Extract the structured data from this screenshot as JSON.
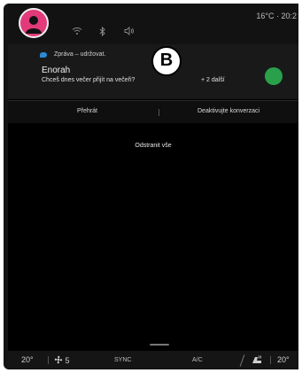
{
  "status_bar": {
    "temperature_text": "16°C · 20:2",
    "icons": [
      "wifi-icon",
      "bluetooth-icon",
      "volume-icon"
    ]
  },
  "notification": {
    "app_label": "Zpráva – udržovat.",
    "sender": "Enorah",
    "message": "Chceš dnes večer přijít na večeři?",
    "more": "+ 2 další",
    "badge": "B"
  },
  "actions": {
    "play": "Přehrát",
    "deactivate": "Deaktivujte konverzaci"
  },
  "clear_all": "Odstranit vše",
  "bottom_bar": {
    "left_temp": "20",
    "left_temp_unit": "°",
    "fan_level": "5",
    "sync": "SYNC",
    "ac": "A/C",
    "right_temp": "20",
    "right_temp_unit": "°"
  },
  "colors": {
    "avatar": "#e23a7a",
    "chat_accent": "#2b8ad8",
    "contact_avatar": "#2aa04a"
  }
}
